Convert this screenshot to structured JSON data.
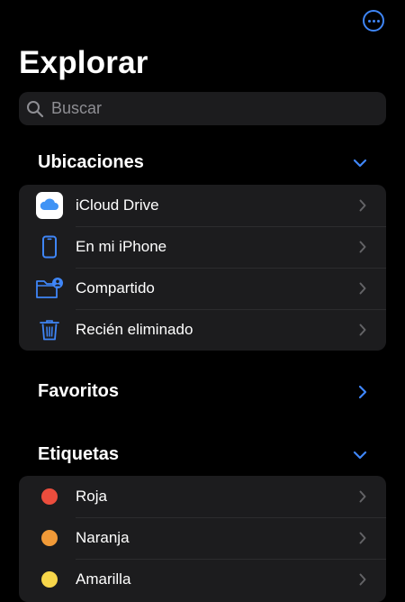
{
  "header": {
    "title": "Explorar",
    "more_icon": "ellipsis-circle-icon"
  },
  "search": {
    "placeholder": "Buscar"
  },
  "locations": {
    "title": "Ubicaciones",
    "items": [
      {
        "label": "iCloud Drive",
        "icon": "icloud-icon"
      },
      {
        "label": "En mi iPhone",
        "icon": "iphone-icon"
      },
      {
        "label": "Compartido",
        "icon": "shared-folder-icon"
      },
      {
        "label": "Recién eliminado",
        "icon": "trash-icon"
      }
    ]
  },
  "favorites": {
    "title": "Favoritos"
  },
  "tags": {
    "title": "Etiquetas",
    "items": [
      {
        "label": "Roja",
        "color": "#eb4d3d"
      },
      {
        "label": "Naranja",
        "color": "#f19a38"
      },
      {
        "label": "Amarilla",
        "color": "#f7d64a"
      }
    ]
  },
  "colors": {
    "accent": "#3f86f8",
    "background": "#000000",
    "group": "#1c1c1e"
  }
}
